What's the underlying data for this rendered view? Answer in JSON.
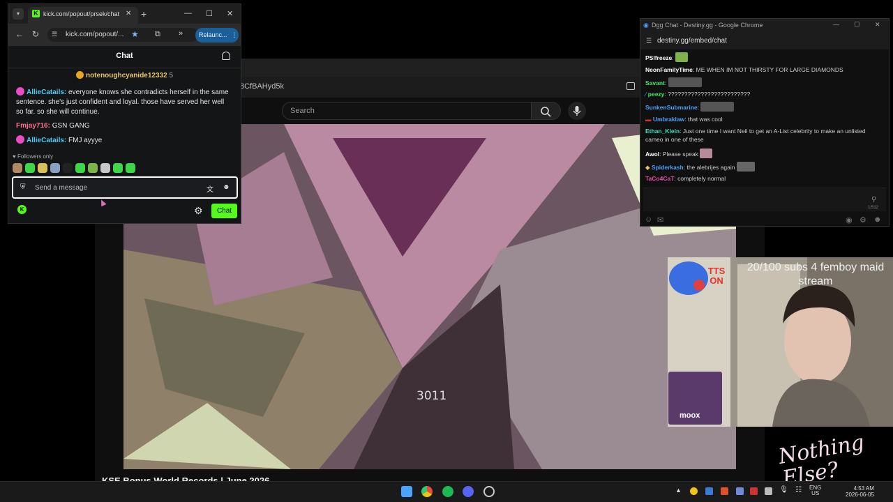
{
  "background_window": {
    "url_fragment": "8CfBAHyd5k",
    "search_placeholder": "Search",
    "video_number": "3011",
    "video_title": "KSE Bonus World Records | June 2026"
  },
  "kick_window": {
    "tab_title": "kick.com/popout/prsek/chat",
    "url": "kick.com/popout/...",
    "relaunch_label": "Relaunc...",
    "chat_title": "Chat",
    "pinned_user": "notenoughcyanide12332",
    "pinned_count": "5",
    "messages": [
      {
        "user": "AllieCatails",
        "color": "#4ecbf5",
        "badge": true,
        "text": "everyone knows she contradicts herself in the same sentence. she's just confident and loyal. those have served her well so far. so she will continue."
      },
      {
        "user": "Fmjay716",
        "color": "#ff6f8f",
        "badge": false,
        "text": "GSN GANG"
      },
      {
        "user": "AllieCatails",
        "color": "#4ecbf5",
        "badge": true,
        "text": "FMJ ayyye"
      }
    ],
    "followers_only": "Followers only",
    "input_placeholder": "Send a message",
    "chat_button": "Chat",
    "accent": "#53fc18"
  },
  "destiny_window": {
    "title": "Dgg Chat - Destiny.gg - Google Chrome",
    "url": "destiny.gg/embed/chat",
    "messages": [
      {
        "user": "PSIfreeze",
        "color": "#ffffff",
        "text": ""
      },
      {
        "user": "NeonFamilyTime",
        "color": "#ffffff",
        "text": "ME WHEN IM NOT THIRSTY FOR LARGE DIAMONDS"
      },
      {
        "user": "Savant",
        "color": "#3ee86a",
        "text": ""
      },
      {
        "user": "peezy",
        "color": "#3ee86a",
        "text": "?????????????????????????"
      },
      {
        "user": "SunkenSubmarine",
        "color": "#4aa3ff",
        "text": ""
      },
      {
        "user": "Umbraklaw",
        "color": "#4aa3ff",
        "text": "that was cool"
      },
      {
        "user": "Ethan_Klein",
        "color": "#3ee0c0",
        "text": "Just one time I want Neil to get an A-List celebrity to make an unlisted cameo in one of these"
      },
      {
        "user": "Awol",
        "color": "#ffffff",
        "text": "Please speak"
      },
      {
        "user": "Spiderkash",
        "color": "#4aa3ff",
        "text": "the alebrijes again"
      },
      {
        "user": "TaCo4CaT",
        "color": "#e64ca5",
        "text": "completely normal"
      }
    ],
    "char_count": "1/512"
  },
  "stream_overlay": {
    "goal_text": "20/100 subs 4 femboy maid stream",
    "tts_label": "TTS ON",
    "friend_label": "moox",
    "brand_text": "Nothing Else?"
  },
  "taskbar": {
    "lang_top": "ENG",
    "lang_bottom": "US",
    "time": "4:53 AM",
    "date": "2026-06-05"
  }
}
